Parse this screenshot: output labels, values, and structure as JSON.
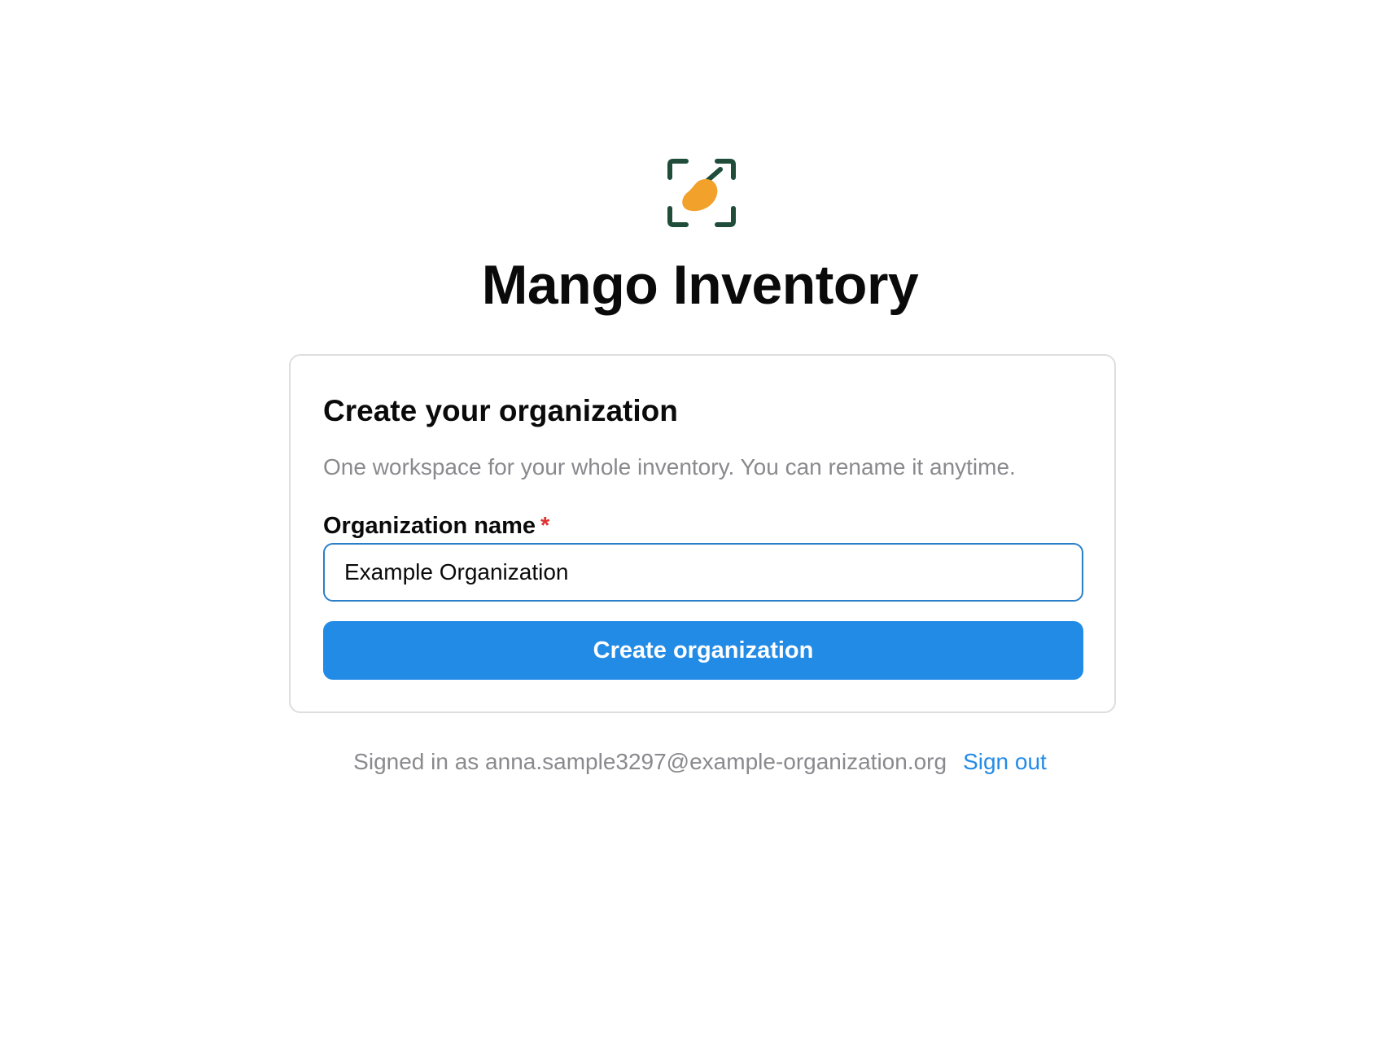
{
  "app": {
    "title": "Mango Inventory",
    "logo_icon": "mango-scan-icon",
    "colors": {
      "logo_frame": "#1f4d3a",
      "logo_mango": "#f2a12a",
      "accent": "#228be6",
      "required": "#e03131",
      "muted_text": "#8a8a8e"
    }
  },
  "card": {
    "title": "Create your organization",
    "description": "One workspace for your whole inventory. You can rename it anytime.",
    "field": {
      "label": "Organization name",
      "required_mark": "*",
      "value": "Example Organization"
    },
    "submit_label": "Create organization"
  },
  "footer": {
    "signed_in_text": "Signed in as anna.sample3297@example-organization.org",
    "sign_out_label": "Sign out"
  }
}
